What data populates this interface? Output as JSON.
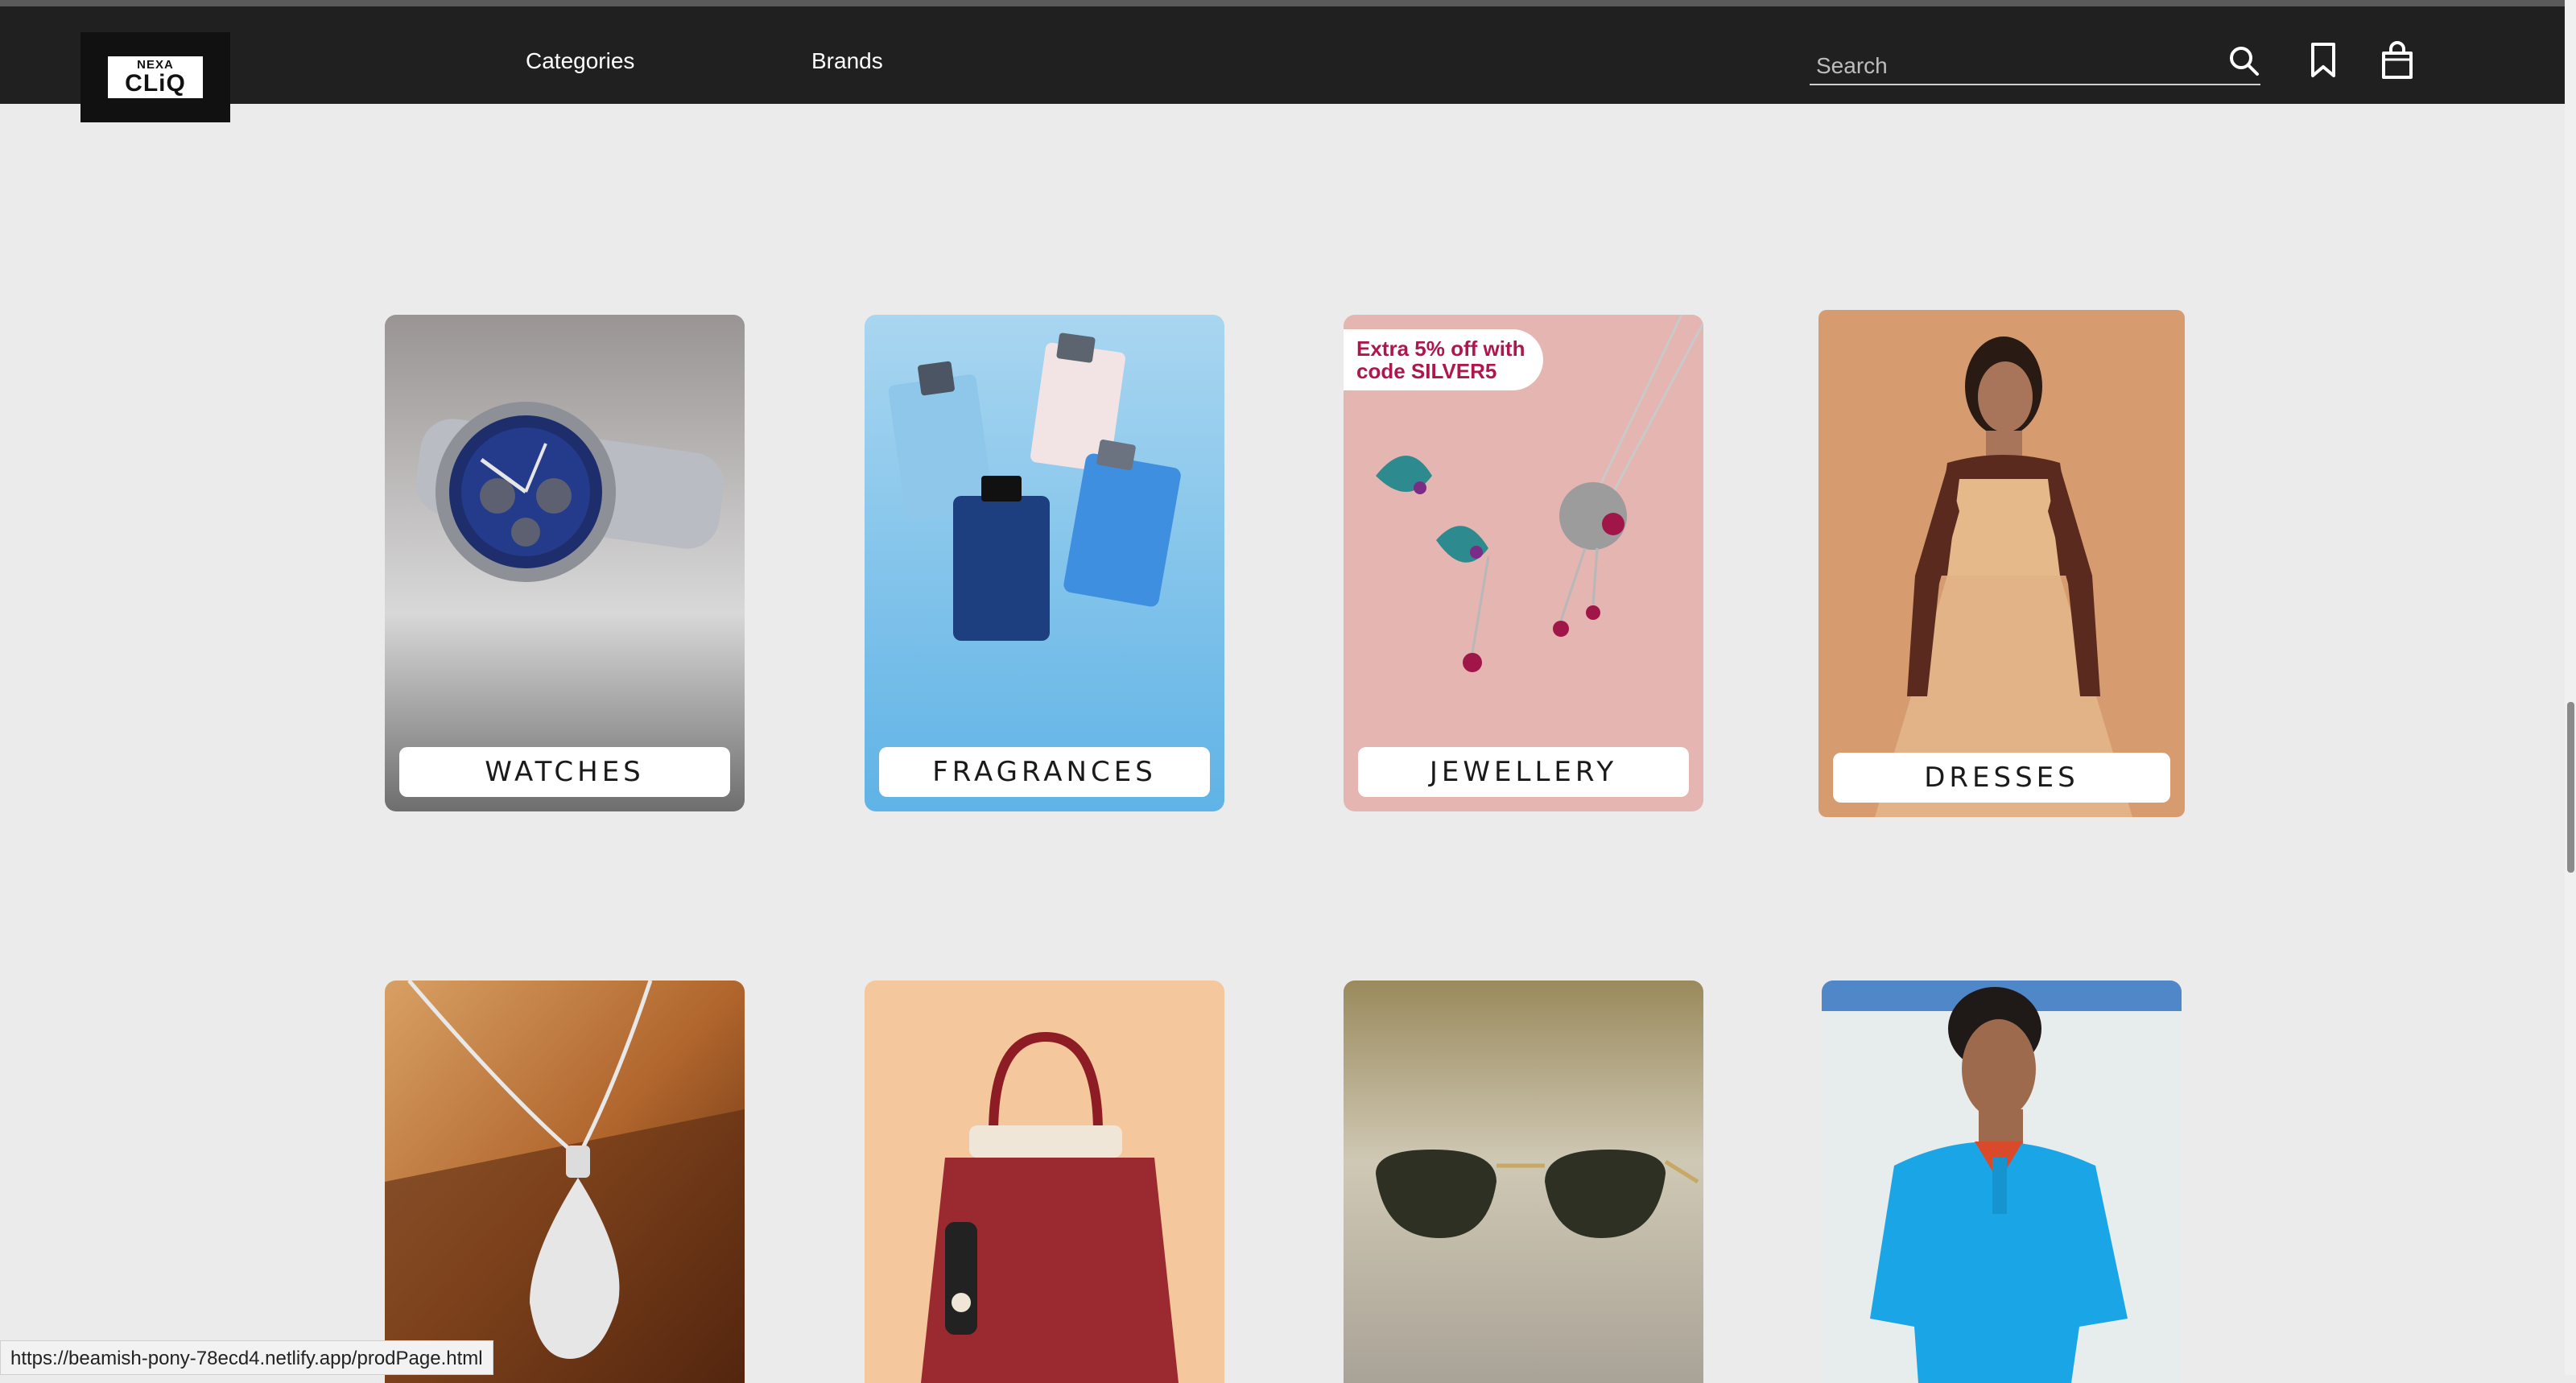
{
  "brand": {
    "top": "NEXA",
    "bottom": "CLiQ"
  },
  "nav": {
    "categories": "Categories",
    "brands": "Brands"
  },
  "search": {
    "placeholder": "Search"
  },
  "icons": {
    "search": "search-icon",
    "wishlist": "bookmark-icon",
    "bag": "shopping-bag-icon"
  },
  "cards": [
    {
      "label": "WATCHES"
    },
    {
      "label": "FRAGRANCES"
    },
    {
      "label": "JEWELLERY",
      "promo": "Extra 5% off with code SILVER5"
    },
    {
      "label": "DRESSES"
    }
  ],
  "status_url": "https://beamish-pony-78ecd4.netlify.app/prodPage.html",
  "colors": {
    "navbar": "#202020",
    "background": "#ebebeb",
    "promo_text": "#b0164e"
  }
}
